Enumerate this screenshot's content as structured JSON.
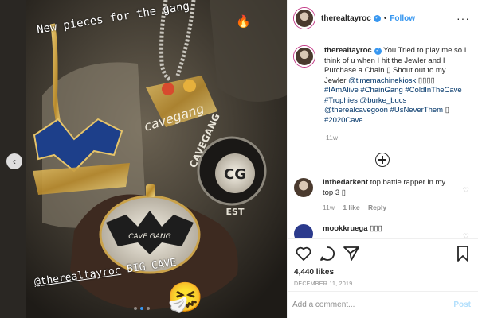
{
  "media": {
    "caption_top": "New pieces for the gang",
    "caption_top_emoji": "🔥",
    "caption_bottom_handle": "@therealtayroc",
    "caption_bottom_rest": " BIG CAVE",
    "sticker_emoji": "🤧",
    "pendant_text_cavegang": "cavegang",
    "pendant_text_cavegang_caps": "CAVEGANG",
    "pendant_text_est": "EST",
    "pendant_text_cg": "CG",
    "pendant_text_cavegang_bat": "CAVE GANG",
    "carousel_total": 3,
    "carousel_active": 2
  },
  "header": {
    "username": "therealtayroc",
    "separator": "•",
    "follow_label": "Follow"
  },
  "caption": {
    "username": "therealtayroc",
    "text": "You Tried to play me so I think of u when I hit the Jewler and I Purchase a Chain ▯ Shout out to my Jewler",
    "mention_jeweler": "@timemachinekiosk",
    "boxes": "▯▯▯▯",
    "tag_alive": "#IAmAlive",
    "tag_chain": "#ChainGang",
    "tag_cold": "#ColdInTheCave",
    "tag_trophies": "#Trophies",
    "mention_burke": "@burke_bucs",
    "mention_cavegoon": "@therealcavegoon",
    "tag_never": "#UsNeverThem",
    "box_single": "▯",
    "tag_2020": "#2020Cave",
    "time": "11w"
  },
  "comments": [
    {
      "username": "inthedarkent",
      "text": "top battle rapper in my top 3 ▯",
      "time": "11w",
      "likes": "1 like",
      "reply": "Reply"
    },
    {
      "username": "mookkruega",
      "text": "▯▯▯"
    }
  ],
  "stats": {
    "likes": "4,440 likes",
    "date": "DECEMBER 11, 2019"
  },
  "composer": {
    "placeholder": "Add a comment...",
    "post_label": "Post"
  },
  "colors": {
    "accent": "#3897f0",
    "link": "#003569",
    "muted": "#8e8e8e",
    "post_disabled": "#b2dffc"
  }
}
